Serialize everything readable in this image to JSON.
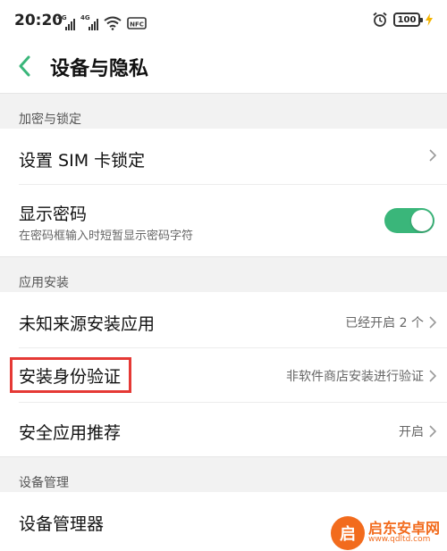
{
  "status_bar": {
    "time": "20:20",
    "signal_1_tag": "4G",
    "signal_2_tag": "4G",
    "nfc_label": "NFC",
    "battery": "100"
  },
  "header": {
    "title": "设备与隐私"
  },
  "sections": [
    {
      "title": "加密与锁定",
      "rows": [
        {
          "title": "设置 SIM 卡锁定",
          "value": ""
        },
        {
          "title": "显示密码",
          "subtitle": "在密码框输入时短暂显示密码字符",
          "toggle": true
        }
      ]
    },
    {
      "title": "应用安装",
      "rows": [
        {
          "title": "未知来源安装应用",
          "value": "已经开启 2 个"
        },
        {
          "title": "安装身份验证",
          "value": "非软件商店安装进行验证"
        },
        {
          "title": "安全应用推荐",
          "value": "开启"
        }
      ]
    },
    {
      "title": "设备管理",
      "rows": [
        {
          "title": "设备管理器",
          "value": ""
        }
      ]
    }
  ],
  "watermark": {
    "name": "启东安卓网",
    "url": "www.qdltd.com"
  },
  "colors": {
    "accent_green": "#3ab67a",
    "highlight_red": "#e53935",
    "watermark_orange": "#f26b1d"
  }
}
